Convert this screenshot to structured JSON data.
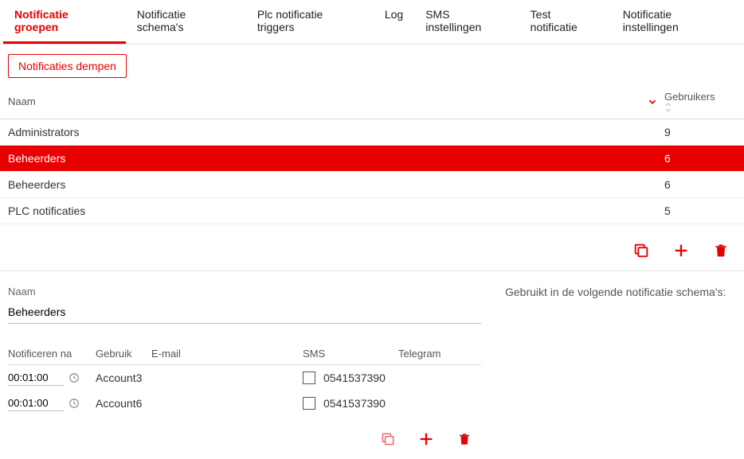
{
  "tabs": [
    {
      "label": "Notificatie groepen",
      "active": true
    },
    {
      "label": "Notificatie schema's",
      "active": false
    },
    {
      "label": "Plc notificatie triggers",
      "active": false
    },
    {
      "label": "Log",
      "active": false
    },
    {
      "label": "SMS instellingen",
      "active": false
    },
    {
      "label": "Test notificatie",
      "active": false
    },
    {
      "label": "Notificatie instellingen",
      "active": false
    }
  ],
  "muteButton": "Notificaties dempen",
  "columns": {
    "name": "Naam",
    "users": "Gebruikers"
  },
  "rows": [
    {
      "name": "Administrators",
      "users": "9",
      "selected": false
    },
    {
      "name": "Beheerders",
      "users": "6",
      "selected": true
    },
    {
      "name": "Beheerders",
      "users": "6",
      "selected": false
    },
    {
      "name": "PLC notificaties",
      "users": "5",
      "selected": false
    }
  ],
  "detail": {
    "nameLabel": "Naam",
    "nameValue": "Beheerders",
    "usedInLabel": "Gebruikt in de volgende notificatie schema's:",
    "subColumns": {
      "notify": "Notificeren na",
      "user": "Gebruik",
      "email": "E-mail",
      "sms": "SMS",
      "telegram": "Telegram"
    },
    "subRows": [
      {
        "time": "00:01:00",
        "user": "Account3",
        "email": "",
        "sms": "0541537390",
        "smsChecked": false,
        "telegram": ""
      },
      {
        "time": "00:01:00",
        "user": "Account6",
        "email": "",
        "sms": "0541537390",
        "smsChecked": false,
        "telegram": ""
      }
    ]
  }
}
